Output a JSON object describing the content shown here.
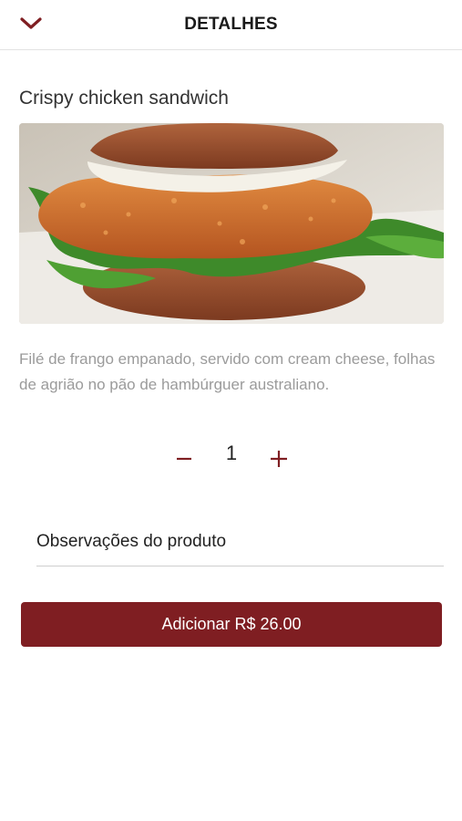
{
  "header": {
    "title": "DETALHES",
    "back_icon": "chevron-down-icon",
    "accent_color": "#7f1e22"
  },
  "product": {
    "name": "Crispy chicken sandwich",
    "image_subject": "crispy chicken sandwich photo",
    "description": "Filé de frango empanado, servido com cream cheese, folhas de agrião no pão de hambúrguer australiano."
  },
  "quantity": {
    "value": "1",
    "minus_icon": "minus-icon",
    "plus_icon": "plus-icon"
  },
  "notes": {
    "placeholder": "Observações do produto",
    "value": ""
  },
  "add_button": {
    "label": "Adicionar R$ 26.00",
    "color": "#7f1e22"
  }
}
